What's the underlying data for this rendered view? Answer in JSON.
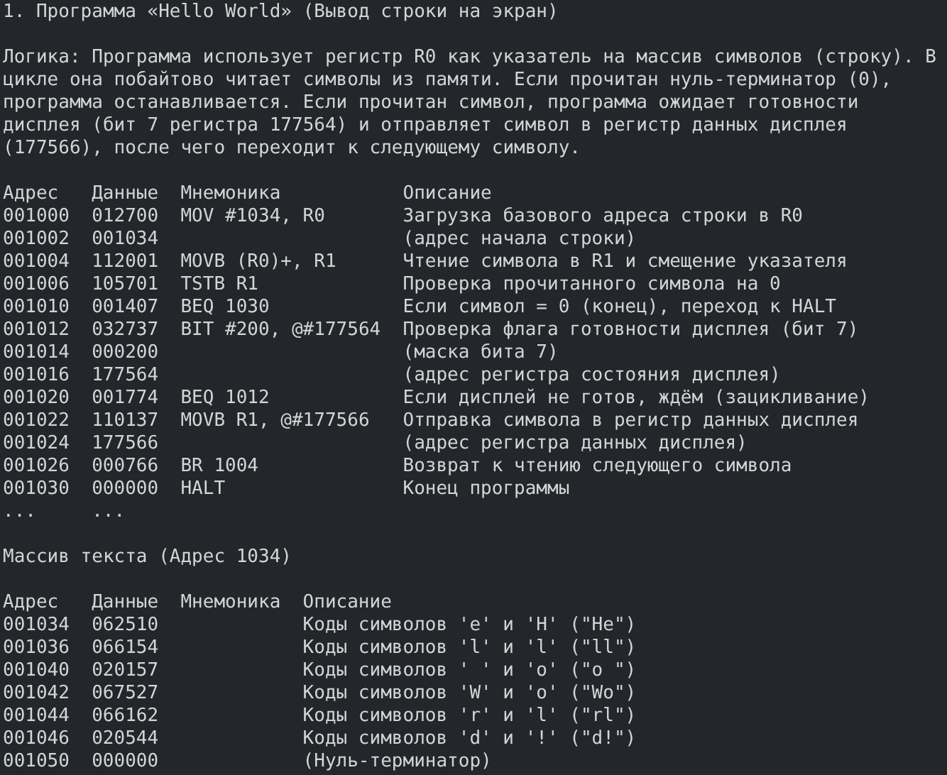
{
  "title": "1. Программа «Hello World» (Вывод строки на экран)",
  "logic": "Логика: Программа использует регистр R0 как указатель на массив символов (строку). В цикле она побайтово читает символы из памяти. Если прочитан нуль-терминатор (0), программа останавливается. Если прочитан символ, программа ожидает готовности дисплея (бит 7 регистра 177564) и отправляет символ в регистр данных дисплея (177566), после чего переходит к следующему символу.",
  "program_table": {
    "columns": [
      "Адрес",
      "Данные",
      "Мнемоника",
      "Описание"
    ],
    "rows": [
      {
        "address": "001000",
        "data": "012700",
        "mnemonic": "MOV #1034, R0",
        "description": "Загрузка базового адреса строки в R0"
      },
      {
        "address": "001002",
        "data": "001034",
        "description": "(адрес начала строки)"
      },
      {
        "address": "001004",
        "data": "112001",
        "mnemonic": "MOVB (R0)+, R1",
        "description": "Чтение символа в R1 и смещение указателя"
      },
      {
        "address": "001006",
        "data": "105701",
        "mnemonic": "TSTB R1",
        "description": "Проверка прочитанного символа на 0"
      },
      {
        "address": "001010",
        "data": "001407",
        "mnemonic": "BEQ 1030",
        "description": "Если символ = 0 (конец), переход к HALT"
      },
      {
        "address": "001012",
        "data": "032737",
        "mnemonic": "BIT #200, @#177564",
        "description": "Проверка флага готовности дисплея (бит 7)"
      },
      {
        "address": "001014",
        "data": "000200",
        "description": "(маска бита 7)"
      },
      {
        "address": "001016",
        "data": "177564",
        "description": "(адрес регистра состояния дисплея)"
      },
      {
        "address": "001020",
        "data": "001774",
        "mnemonic": "BEQ 1012",
        "description": "Если дисплей не готов, ждём (зацикливание)"
      },
      {
        "address": "001022",
        "data": "110137",
        "mnemonic": "MOVB R1, @#177566",
        "description": "Отправка символа в регистр данных дисплея"
      },
      {
        "address": "001024",
        "data": "177566",
        "description": "(адрес регистра данных дисплея)"
      },
      {
        "address": "001026",
        "data": "000766",
        "mnemonic": "BR 1004",
        "description": "Возврат к чтению следующего символа"
      },
      {
        "address": "001030",
        "data": "000000",
        "mnemonic": "HALT",
        "description": "Конец программы"
      },
      {
        "address": "...",
        "data": "..."
      }
    ]
  },
  "text_array": {
    "title": "Массив текста (Адрес 1034)",
    "columns": [
      "Адрес",
      "Данные",
      "Мнемоника",
      "Описание"
    ],
    "rows": [
      {
        "address": "001034",
        "data": "062510",
        "description": "Коды символов 'e' и 'H' (\"He\")"
      },
      {
        "address": "001036",
        "data": "066154",
        "description": "Коды символов 'l' и 'l' (\"ll\")"
      },
      {
        "address": "001040",
        "data": "020157",
        "description": "Коды символов ' ' и 'o' (\"o \")"
      },
      {
        "address": "001042",
        "data": "067527",
        "description": "Коды символов 'W' и 'o' (\"Wo\")"
      },
      {
        "address": "001044",
        "data": "066162",
        "description": "Коды символов 'r' и 'l' (\"rl\")"
      },
      {
        "address": "001046",
        "data": "020544",
        "description": "Коды символов 'd' и '!' (\"d!\")"
      },
      {
        "address": "001050",
        "data": "000000",
        "description": "(Нуль-терминатор)"
      }
    ]
  }
}
